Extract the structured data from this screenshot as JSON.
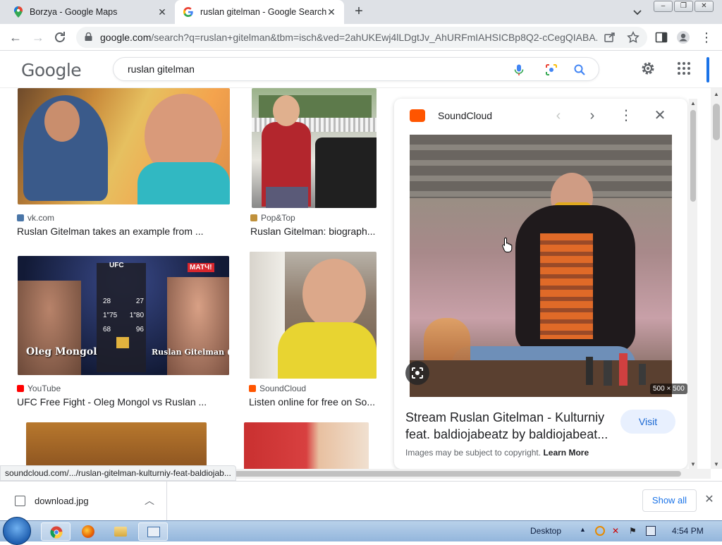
{
  "browser": {
    "tabs": [
      {
        "title": "Borzya - Google Maps",
        "active": false
      },
      {
        "title": "ruslan gitelman - Google Search",
        "active": true
      }
    ],
    "url_host": "google.com",
    "url_rest": "/search?q=ruslan+gitelman&tbm=isch&ved=2ahUKEwj4lLDgtJv_AhURFmIAHSICBp8Q2-cCegQIABA..."
  },
  "google": {
    "logo": "Google",
    "query": "ruslan gitelman"
  },
  "results": [
    {
      "source": "vk.com",
      "title": "Ruslan Gitelman takes an example from ...",
      "favicon_color": "#4a76a8"
    },
    {
      "source": "Pop&Top",
      "title": "Ruslan Gitelman: biograph...",
      "favicon_color": "#c0913b"
    },
    {
      "source": "YouTube",
      "title": "UFC Free Fight - Oleg Mongol vs Ruslan ...",
      "favicon_color": "#ff0000"
    },
    {
      "source": "SoundCloud",
      "title": "Listen online for free on So...",
      "favicon_color": "#ff5500"
    }
  ],
  "ufc_thumb": {
    "logo": "UFC",
    "channel": "МАТЧ!",
    "left_name": "Oleg Mongol",
    "right_name": "Ruslan Gitelman (C)",
    "stats": [
      [
        "28",
        "27"
      ],
      [
        "1\"75",
        "1\"80"
      ],
      [
        "68",
        "96"
      ]
    ]
  },
  "panel": {
    "source": "SoundCloud",
    "dimensions": "500 × 500",
    "title": "Stream Ruslan Gitelman - Kulturniy feat. baldiojabeatz by baldiojabeat...",
    "visit_label": "Visit",
    "copyright_text": "Images may be subject to copyright.",
    "learn_more": "Learn More",
    "accent_color": "#ff5500"
  },
  "status_url": "soundcloud.com/.../ruslan-gitelman-kulturniy-feat-baldiojab...",
  "downloads": {
    "file": "download.jpg",
    "show_all": "Show all"
  },
  "taskbar": {
    "desktop_label": "Desktop",
    "time": "4:54 PM"
  }
}
